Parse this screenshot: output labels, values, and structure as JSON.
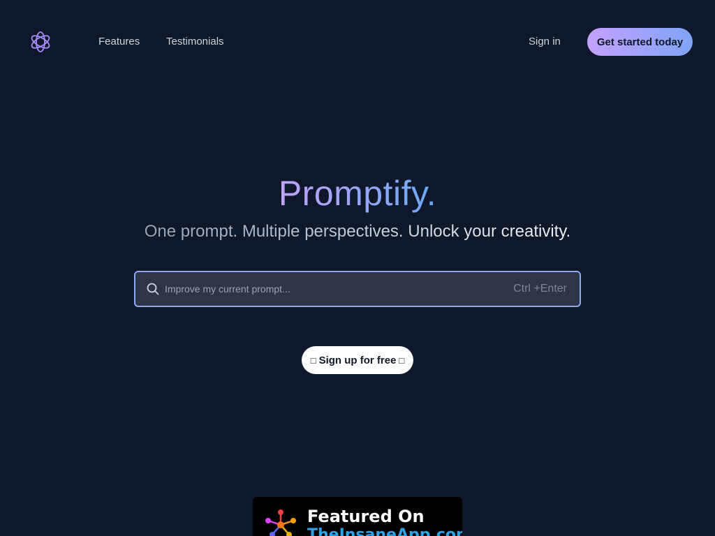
{
  "header": {
    "logo_icon": "openai-knot-icon",
    "nav": [
      {
        "label": "Features"
      },
      {
        "label": "Testimonials"
      }
    ],
    "sign_in_label": "Sign in",
    "cta_label": "Get started today"
  },
  "hero": {
    "title": "Promptify.",
    "subtitle": "One prompt. Multiple perspectives. Unlock your creativity."
  },
  "search": {
    "icon": "search-icon",
    "placeholder": "Improve my current prompt...",
    "value": "",
    "shortcut": "Ctrl +Enter"
  },
  "signup_free": {
    "icon_left": "□",
    "label": "Sign up for free",
    "icon_right": "□"
  },
  "featured": {
    "line1": "Featured On",
    "line2": "TheInsaneApp.com"
  },
  "colors": {
    "background": "#0f172a",
    "accent_gradient_start": "#c4a1fb",
    "accent_gradient_end": "#7fa5f7",
    "search_border": "#93a8f4",
    "search_bg": "#2e3547",
    "badge_link": "#2ea3e8"
  }
}
